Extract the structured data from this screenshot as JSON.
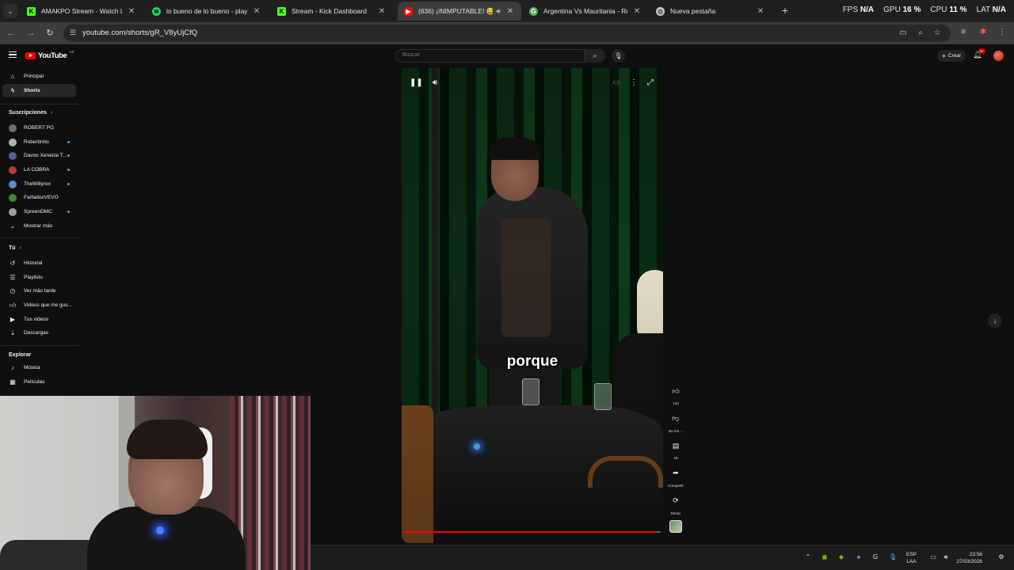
{
  "browser": {
    "tabs": [
      {
        "title": "AMAKPO Stream - Watch Live o",
        "icon": "kick-icon",
        "color": "#53fc18"
      },
      {
        "title": "lo bueno de lo bueno - playlist",
        "icon": "spotify-icon",
        "color": "#1ed760"
      },
      {
        "title": "Stream - Kick Dashboard",
        "icon": "kick-icon",
        "color": "#53fc18"
      },
      {
        "title": "(636) ¡INIMPUTABLE! 😂",
        "icon": "youtube-icon",
        "color": "#ff0000",
        "active": true
      },
      {
        "title": "Argentina Vs Mauritania - Resu",
        "icon": "google-icon",
        "color": "#4caf50"
      },
      {
        "title": "Nueva pestaña",
        "icon": "chrome-icon",
        "color": "#cccccc"
      }
    ],
    "url": "youtube.com/shorts/gR_V8yUjCfQ",
    "hud": {
      "fps_label": "FPS",
      "fps_value": "N/A",
      "gpu_label": "GPU",
      "gpu_value": "16 %",
      "cpu_label": "CPU",
      "cpu_value": "11 %",
      "lat_label": "LAT",
      "lat_value": "N/A"
    }
  },
  "youtube": {
    "logo_text": "YouTube",
    "country_code": "AR",
    "search_placeholder": "Buscar",
    "create_label": "Crear",
    "notification_badge": "9+"
  },
  "sidebar": {
    "main": [
      {
        "label": "Principal",
        "icon": "home-icon"
      },
      {
        "label": "Shorts",
        "icon": "shorts-icon",
        "active": true
      }
    ],
    "subscriptions_heading": "Suscripciones",
    "subscriptions": [
      {
        "label": "ROBERT PG",
        "color": "#6d6d6d",
        "live_dot": false
      },
      {
        "label": "Robertinho",
        "color": "#a8b3bf",
        "live_dot": true
      },
      {
        "label": "Davoo Xeneize T...",
        "color": "#5a5d9a",
        "live_dot": true
      },
      {
        "label": "LA COBRA",
        "color": "#b83a3a",
        "live_dot": true
      },
      {
        "label": "TheWillyrex",
        "color": "#5b8fc9",
        "live_dot": true
      },
      {
        "label": "FarfadoxVEVO",
        "color": "#3f8a3a",
        "live_dot": false
      },
      {
        "label": "SpreenDMC",
        "color": "#9aa2a8",
        "live_dot": true
      }
    ],
    "show_more": "Mostrar más",
    "you_heading": "Tú",
    "you": [
      {
        "label": "Historial",
        "icon": "history-icon"
      },
      {
        "label": "Playlists",
        "icon": "playlists-icon"
      },
      {
        "label": "Ver más tarde",
        "icon": "watch-later-icon"
      },
      {
        "label": "Videos que me gus...",
        "icon": "liked-icon"
      },
      {
        "label": "Tus videos",
        "icon": "your-videos-icon"
      },
      {
        "label": "Descargas",
        "icon": "downloads-icon"
      }
    ],
    "explore_heading": "Explorar",
    "explore": [
      {
        "label": "Música",
        "icon": "music-icon"
      },
      {
        "label": "Películas",
        "icon": "movies-icon"
      }
    ]
  },
  "short": {
    "caption": "porque",
    "progress_fraction": 0.98
  },
  "actions": {
    "like_count": "143",
    "dislike_label": "No me ...",
    "comment_count": "18",
    "share_label": "Compartir",
    "remix_label": "Remix"
  },
  "taskbar": {
    "lang_top": "ESP",
    "lang_bottom": "LAA",
    "time": "23:56",
    "date": "27/03/2026"
  }
}
